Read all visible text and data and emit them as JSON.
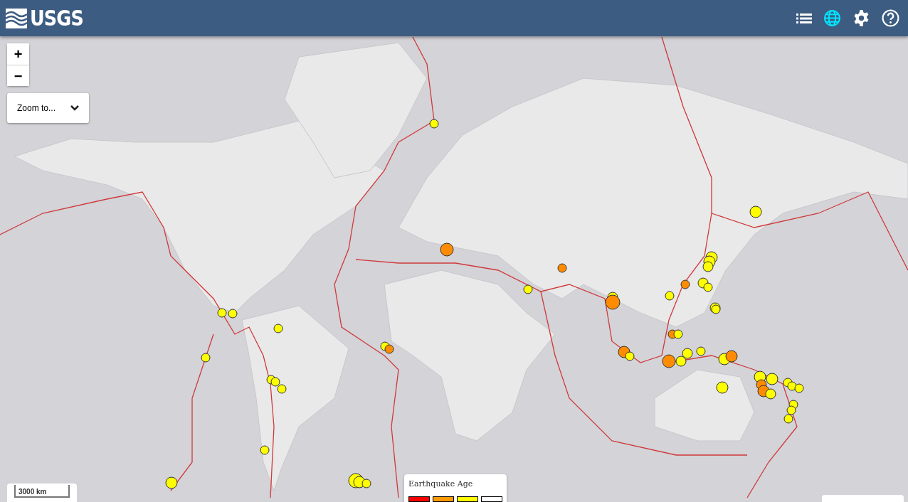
{
  "header": {
    "logo": "USGS"
  },
  "zoom_controls": {
    "zoom_in": "+",
    "zoom_out": "−"
  },
  "zoom_to": {
    "label": "Zoom to..."
  },
  "quakes": [
    {
      "color": "#ffff00"
    },
    {
      "color": "#ff8c00"
    },
    {
      "color": "#ff8c00"
    },
    {
      "color": "#ffff00"
    },
    {
      "color": "#ffff00"
    },
    {
      "color": "#ffff00"
    },
    {
      "color": "#ffff00"
    },
    {
      "color": "#ffff00"
    },
    {
      "color": "#ffff00"
    },
    {
      "color": "#ffff00"
    },
    {
      "color": "#ffff00"
    },
    {
      "color": "#ffff00"
    },
    {
      "color": "#ffff00"
    },
    {
      "color": "#ffff00"
    },
    {
      "color": "#ffff00"
    },
    {
      "color": "#ffff00"
    },
    {
      "color": "#ffff00"
    },
    {
      "color": "#ff8c00"
    },
    {
      "color": "#ffff00"
    },
    {
      "color": "#ff8c00"
    },
    {
      "color": "#ff8c00"
    },
    {
      "color": "#ffff00"
    },
    {
      "color": "#ffff00"
    },
    {
      "color": "#ff8c00"
    },
    {
      "color": "#ffff00"
    },
    {
      "color": "#ffff00"
    },
    {
      "color": "#ffff00"
    },
    {
      "color": "#ffff00"
    },
    {
      "color": "#ffff00"
    },
    {
      "color": "#ffff00"
    },
    {
      "color": "#ffff00"
    },
    {
      "color": "#ff8c00"
    },
    {
      "color": "#ffff00"
    },
    {
      "color": "#ff8c00"
    },
    {
      "color": "#ffff00"
    },
    {
      "color": "#ffff00"
    },
    {
      "color": "#ffff00"
    },
    {
      "color": "#ffff00"
    },
    {
      "color": "#ff8c00"
    },
    {
      "color": "#ffff00"
    },
    {
      "color": "#ffff00"
    },
    {
      "color": "#ffff00"
    },
    {
      "color": "#ffff00"
    },
    {
      "color": "#ff8c00"
    },
    {
      "color": "#ff8c00"
    },
    {
      "color": "#ffff00"
    },
    {
      "color": "#ffff00"
    },
    {
      "color": "#ffff00"
    },
    {
      "color": "#ffff00"
    },
    {
      "color": "#ffff00"
    },
    {
      "color": "#ffff00"
    },
    {
      "color": "#ffff00"
    }
  ],
  "scale": {
    "label": "3000 km"
  },
  "legend": {
    "title": "Earthquake Age",
    "swatches": [
      {
        "color": "#ff0000"
      },
      {
        "color": "#ff9900"
      },
      {
        "color": "#ffff00"
      },
      {
        "color": "#ffffff"
      }
    ]
  }
}
